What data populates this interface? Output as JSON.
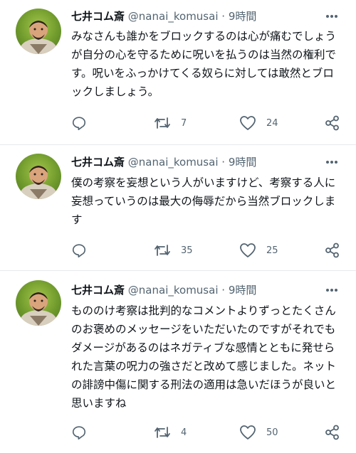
{
  "colors": {
    "text": "#0f1419",
    "secondary": "#536471",
    "divider": "#e6e9ec"
  },
  "tweets": [
    {
      "name": "七井コム斎",
      "handle": "@nanai_komusai",
      "sep": "·",
      "time": "9時間",
      "text": "みなさんも誰かをブロックするのは心が痛むでしょうが自分の心を守るために呪いを払うのは当然の権利です。呪いをふっかけてくる奴らに対しては敢然とブロックしましょう。",
      "replies": "",
      "retweets": "7",
      "likes": "24"
    },
    {
      "name": "七井コム斎",
      "handle": "@nanai_komusai",
      "sep": "·",
      "time": "9時間",
      "text": "僕の考察を妄想という人がいますけど、考察する人に妄想っていうのは最大の侮辱だから当然ブロックします",
      "replies": "",
      "retweets": "35",
      "likes": "25"
    },
    {
      "name": "七井コム斎",
      "handle": "@nanai_komusai",
      "sep": "·",
      "time": "9時間",
      "text": "もののけ考察は批判的なコメントよりずっとたくさんのお褒めのメッセージをいただいたのですがそれでもダメージがあるのはネガティブな感情とともに発せられた言葉の呪力の強さだと改めて感じました。ネットの誹謗中傷に関する刑法の適用は急いだほうが良いと思いますね",
      "replies": "",
      "retweets": "4",
      "likes": "50"
    }
  ],
  "icons": {
    "avatar": "avatar-photo",
    "more": "more-dots-icon",
    "reply": "reply-icon",
    "retweet": "retweet-icon",
    "like": "heart-icon",
    "share": "share-icon"
  }
}
